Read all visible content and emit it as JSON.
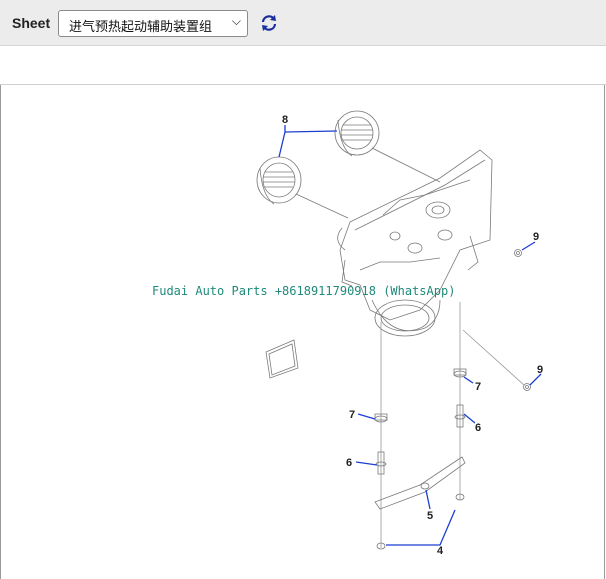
{
  "toolbar": {
    "sheet_label": "Sheet",
    "sheet_selected": "进气预热起动辅助装置组",
    "refresh_icon": "refresh-icon"
  },
  "diagram": {
    "watermark": "Fudai Auto Parts +8618911790918 (WhatsApp)",
    "callouts": {
      "c8": "8",
      "c9a": "9",
      "c9b": "9",
      "c7a": "7",
      "c7b": "7",
      "c6a": "6",
      "c6b": "6",
      "c5": "5",
      "c4": "4"
    }
  },
  "colors": {
    "callout_line": "#1a3fd1",
    "watermark": "#1f8a7a",
    "toolbar_bg": "#ececec"
  }
}
